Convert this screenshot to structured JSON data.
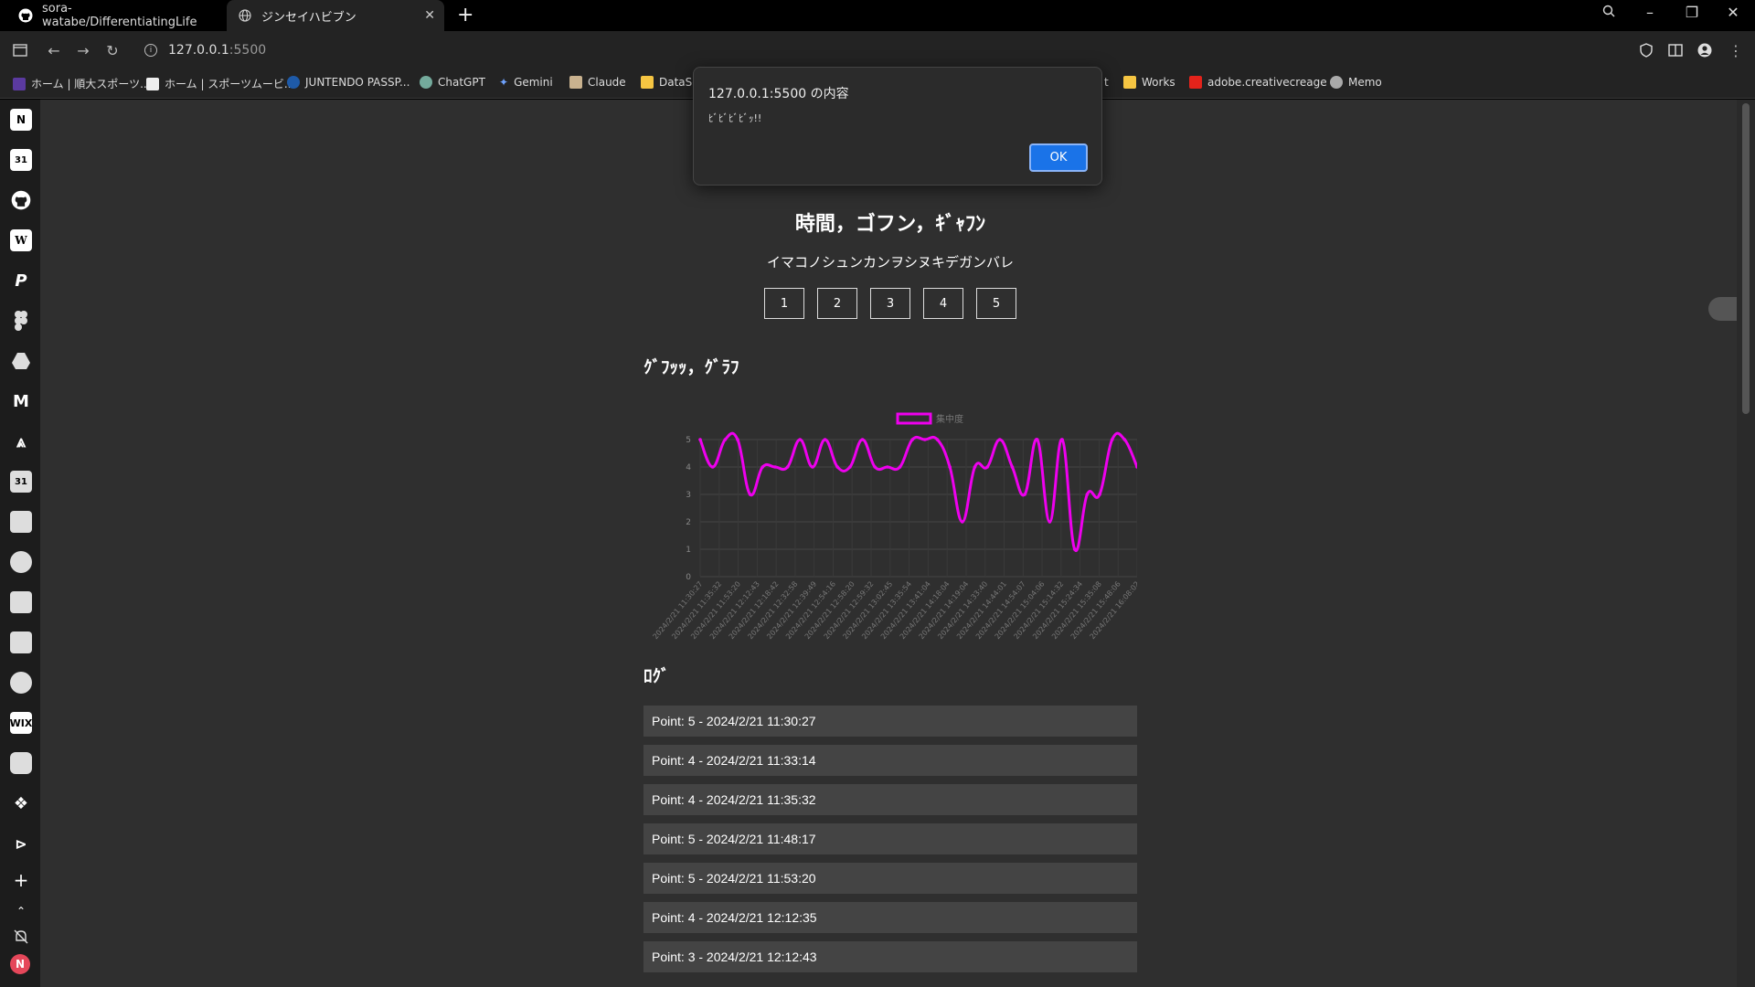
{
  "browser": {
    "tabs": [
      {
        "label": "sora-watabe/DifferentiatingLife"
      },
      {
        "label": "ジンセイハビブン"
      }
    ],
    "url": {
      "host": "127.0.0.1",
      "port": ":5500"
    },
    "bookmarks": [
      {
        "label": "ホーム | 順大スポーツ..."
      },
      {
        "label": "ホーム | スポーツムービ..."
      },
      {
        "label": "JUNTENDO PASSP..."
      },
      {
        "label": "ChatGPT"
      },
      {
        "label": "Gemini"
      },
      {
        "label": "Claude"
      },
      {
        "label": "DataSc"
      },
      {
        "label": "t"
      },
      {
        "label": "Works"
      },
      {
        "label": "adobe.creativecreage"
      },
      {
        "label": "Memo"
      }
    ]
  },
  "page": {
    "title": "時間，ゴフン，ｷﾞｬﾌﾝ",
    "subtitle": "イマコノシュンカンヲシヌキデガンバレ",
    "point_buttons": [
      "1",
      "2",
      "3",
      "4",
      "5"
    ],
    "graph_heading": "ｸﾞﾌｯｯ，ｸﾞﾗﾌ",
    "log_heading": "ﾛｸﾞ",
    "log_entries": [
      "Point: 5 - 2024/2/21 11:30:27",
      "Point: 4 - 2024/2/21 11:33:14",
      "Point: 4 - 2024/2/21 11:35:32",
      "Point: 5 - 2024/2/21 11:48:17",
      "Point: 5 - 2024/2/21 11:53:20",
      "Point: 4 - 2024/2/21 12:12:35",
      "Point: 3 - 2024/2/21 12:12:43"
    ]
  },
  "dialog": {
    "title": "127.0.0.1:5500 の内容",
    "message": "ﾋﾞﾋﾞﾋﾞﾋﾞｯ!!",
    "ok_label": "OK"
  },
  "sidebar": {
    "avatar_letter": "N"
  },
  "chart_data": {
    "type": "line",
    "series": [
      {
        "name": "集中度",
        "color": "#ee00ee",
        "values": [
          5,
          4,
          5,
          5,
          3,
          4,
          4,
          4,
          5,
          4,
          5,
          4,
          4,
          5,
          4,
          4,
          4,
          5,
          5,
          5,
          4,
          2,
          4,
          4,
          5,
          4,
          3,
          5,
          2,
          5,
          1,
          3,
          3,
          5,
          5,
          4
        ]
      }
    ],
    "x_tick_labels": [
      "2024/2/21 11:30:27",
      "2024/2/21 11:35:32",
      "2024/2/21 11:53:20",
      "2024/2/21 12:12:43",
      "2024/2/21 12:18:42",
      "2024/2/21 12:32:58",
      "2024/2/21 12:39:49",
      "2024/2/21 12:54:16",
      "2024/2/21 12:58:20",
      "2024/2/21 12:59:32",
      "2024/2/21 13:02:45",
      "2024/2/21 13:35:54",
      "2024/2/21 13:41:04",
      "2024/2/21 14:18:04",
      "2024/2/21 14:19:04",
      "2024/2/21 14:33:40",
      "2024/2/21 14:44:01",
      "2024/2/21 14:54:07",
      "2024/2/21 15:04:06",
      "2024/2/21 15:14:32",
      "2024/2/21 15:24:34",
      "2024/2/21 15:35:08",
      "2024/2/21 15:48:06",
      "2024/2/21 16:08:02"
    ],
    "y_ticks": [
      "0",
      "1",
      "2",
      "3",
      "4",
      "5"
    ],
    "ylim": [
      0,
      5
    ],
    "grid": true,
    "legend_position": "top-center"
  }
}
